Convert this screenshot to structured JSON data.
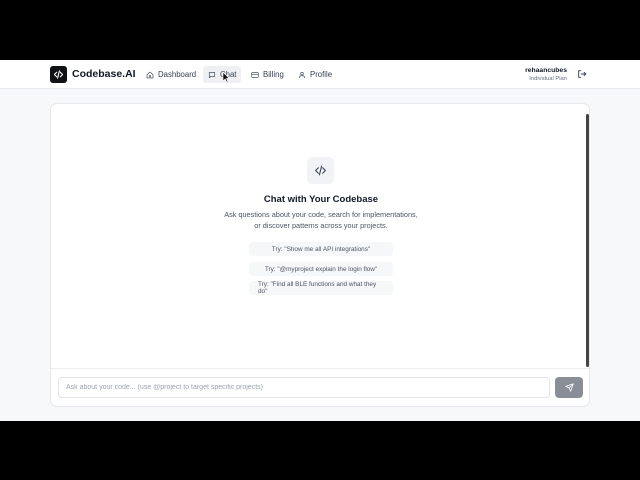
{
  "brand": {
    "name": "Codebase.AI",
    "icon": "code-icon"
  },
  "nav": [
    {
      "label": "Dashboard",
      "icon": "home-icon"
    },
    {
      "label": "Chat",
      "icon": "chat-icon",
      "active": true
    },
    {
      "label": "Billing",
      "icon": "card-icon"
    },
    {
      "label": "Profile",
      "icon": "user-icon"
    }
  ],
  "user": {
    "name": "rehaancubes",
    "plan": "Individual Plan",
    "logout_icon": "logout-icon"
  },
  "hero": {
    "icon": "code-icon",
    "title": "Chat with Your Codebase",
    "subtitle_line1": "Ask questions about your code, search for implementations,",
    "subtitle_line2": "or discover patterns across your projects."
  },
  "suggestions": [
    "Try: \"Show me all API integrations\"",
    "Try: \"@myproject explain the login flow\"",
    "Try: \"Find all BLE functions and what they do\""
  ],
  "composer": {
    "placeholder": "Ask about your code... (use @project to target specific projects)",
    "value": "",
    "send_icon": "send-icon"
  },
  "colors": {
    "brand_dark": "#0f1115",
    "page_bg": "#f7f8fa",
    "send_button": "#8a8f97"
  }
}
